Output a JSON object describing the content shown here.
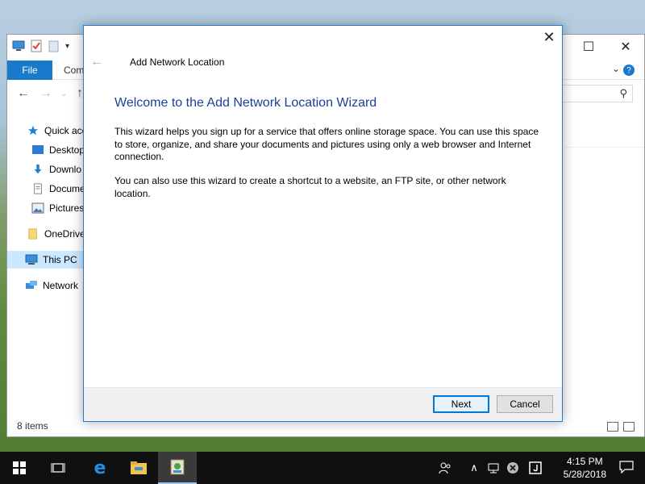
{
  "explorer": {
    "ribbon": {
      "file_tab": "File",
      "computer_tab": "Comp"
    },
    "sidebar": {
      "items": [
        {
          "label": "Quick acc"
        },
        {
          "label": "Desktop"
        },
        {
          "label": "Downlo"
        },
        {
          "label": "Docume"
        },
        {
          "label": "Pictures"
        },
        {
          "label": "OneDrive"
        },
        {
          "label": "This PC"
        },
        {
          "label": "Network"
        }
      ]
    },
    "status": {
      "item_count": "8 items"
    }
  },
  "wizard": {
    "window_title": "Add Network Location",
    "heading": "Welcome to the Add Network Location Wizard",
    "paragraph1": "This wizard helps you sign up for a service that offers online storage space.  You can use this space to store, organize, and share your documents and pictures using only a web browser and Internet connection.",
    "paragraph2": "You can also use this wizard to create a shortcut to a website, an FTP site, or other network location.",
    "next_label": "Next",
    "cancel_label": "Cancel"
  },
  "taskbar": {
    "time": "4:15 PM",
    "date": "5/28/2018"
  },
  "colors": {
    "accent": "#0078d7",
    "heading": "#1a3f97",
    "file_tab": "#1979ca",
    "taskbar": "#101010"
  }
}
